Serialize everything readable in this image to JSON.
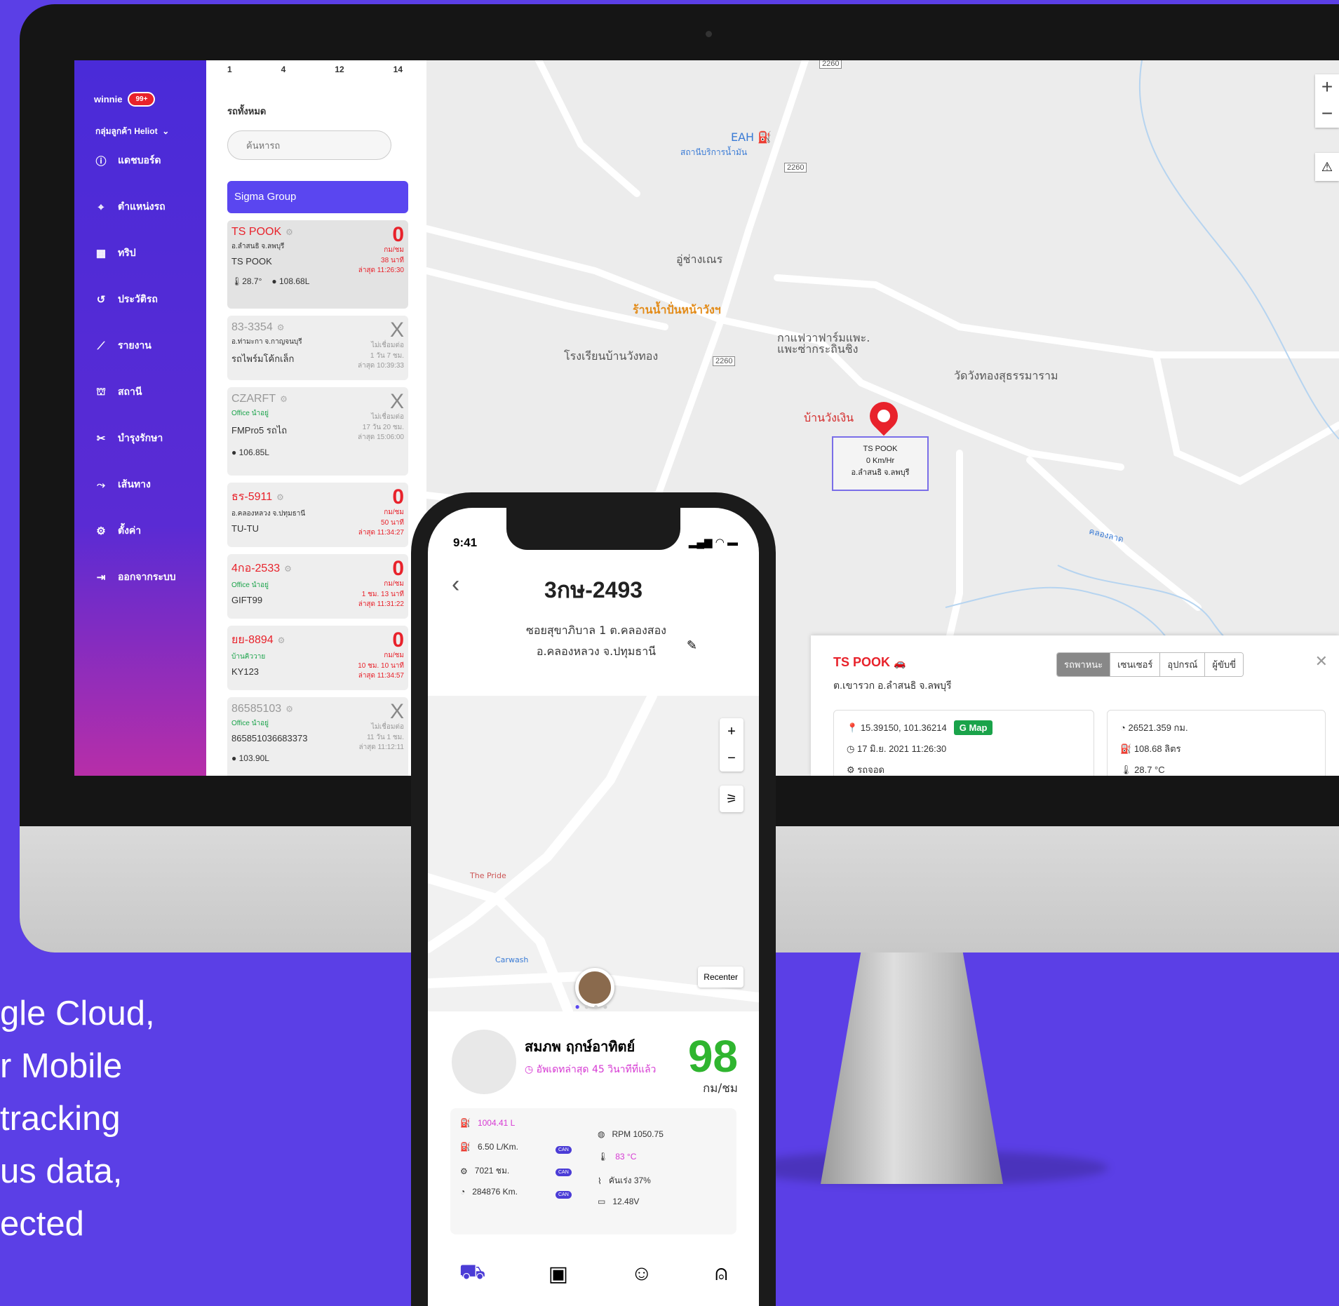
{
  "marketing_lines": [
    "gle Cloud,",
    "r Mobile",
    "tracking",
    "us data,",
    "ected"
  ],
  "sidebar": {
    "user": "winnie",
    "badge": "99+",
    "group": "กลุ่มลูกค้า Heliot",
    "items": [
      {
        "icon": "info-icon",
        "label": "แดชบอร์ด"
      },
      {
        "icon": "location-icon",
        "label": "ตำแหน่งรถ"
      },
      {
        "icon": "map-icon",
        "label": "ทริป"
      },
      {
        "icon": "history-icon",
        "label": "ประวัติรถ"
      },
      {
        "icon": "chart-icon",
        "label": "รายงาน"
      },
      {
        "icon": "station-icon",
        "label": "สถานี"
      },
      {
        "icon": "tools-icon",
        "label": "บำรุงรักษา"
      },
      {
        "icon": "route-icon",
        "label": "เส้นทาง"
      },
      {
        "icon": "gear-icon",
        "label": "ตั้งค่า"
      },
      {
        "icon": "logout-icon",
        "label": "ออกจากระบบ"
      }
    ]
  },
  "list": {
    "counts": [
      "1",
      "4",
      "12",
      "14"
    ],
    "title": "รถทั้งหมด",
    "search_placeholder": "ค้นหารถ",
    "group": "Sigma Group",
    "cards": [
      {
        "name": "TS POOK",
        "loc": "อ.ลำสนธิ จ.ลพบุรี",
        "plate": "TS POOK",
        "big": "0",
        "r1": "กม/ชม",
        "r2": "38 นาที",
        "r3": "ล่าสุด 11:26:30",
        "temp": "28.7°",
        "fuel": "108.68L"
      },
      {
        "name": "83-3354",
        "loc": "อ.ท่ามะกา จ.กาญจนบุรี",
        "plate": "รถไพร์มโค้กเล็ก",
        "big": "X",
        "r1": "ไม่เชื่อมต่อ",
        "r2": "1 วัน 7 ชม.",
        "r3": "ล่าสุด 10:39:33"
      },
      {
        "name": "CZARFT",
        "loc": "Office นำอยู่",
        "plate": "FMPro5 รถไถ",
        "big": "X",
        "r1": "ไม่เชื่อมต่อ",
        "r2": "17 วัน 20 ชม.",
        "r3": "ล่าสุด 15:06:00",
        "fuel": "106.85L"
      },
      {
        "name": "ธร-5911",
        "loc": "อ.คลองหลวง จ.ปทุมธานี",
        "plate": "TU-TU",
        "big": "0",
        "r1": "กม/ชม",
        "r2": "50 นาที",
        "r3": "ล่าสุด 11:34:27"
      },
      {
        "name": "4กอ-2533",
        "loc": "Office นำอยู่",
        "plate": "GIFT99",
        "big": "0",
        "r1": "กม/ชม",
        "r2": "1 ชม. 13 นาที",
        "r3": "ล่าสุด 11:31:22"
      },
      {
        "name": "ยย-8894",
        "loc": "บ้านคิววาย",
        "plate": "KY123",
        "big": "0",
        "r1": "กม/ชม",
        "r2": "10 ชม. 10 นาที",
        "r3": "ล่าสุด 11:34:57"
      },
      {
        "name": "86585103",
        "loc": "Office นำอยู่",
        "plate": "865851036683373",
        "big": "X",
        "r1": "ไม่เชื่อมต่อ",
        "r2": "11 วัน 1 ชม.",
        "r3": "ล่าสุด 11:12:11"
      }
    ],
    "partial": "103.90L"
  },
  "map": {
    "pois": [
      "EAH",
      "สถานีบริการน้ำมัน",
      "อู่ช่างเณร",
      "ร้านน้ำปั่นหน้าวังฯ",
      "กาแฟวาฟาร์มแพะ.",
      "แพะซ่ากระถินชิง",
      "โรงเรียนบ้านวังทอง",
      "วัดวังทองสุธรรมาราม",
      "บ้านวังเงิน",
      "คลองลาด"
    ],
    "road_tags": [
      "2260",
      "2260",
      "2260"
    ],
    "popup": {
      "name": "TS POOK",
      "speed": "0 Km/Hr",
      "loc": "อ.ลำสนธิ จ.ลพบุรี"
    },
    "zoom_in": "+",
    "zoom_out": "−"
  },
  "detail": {
    "name": "TS POOK",
    "address": "ต.เขารวก อ.ลำสนธิ จ.ลพบุรี",
    "tabs": [
      "รถพาหนะ",
      "เซนเซอร์",
      "อุปกรณ์",
      "ผู้ขับขี่"
    ],
    "coords": "15.39150, 101.36214",
    "gmap": "Map",
    "datetime": "17 มิ.ย. 2021 11:26:30",
    "status": "รถจอด",
    "odometer": "26521.359 กม.",
    "fuel": "108.68 ลิตร",
    "temp": "28.7 °C"
  },
  "phone": {
    "time": "9:41",
    "plate": "3กษ-2493",
    "addr1": "ซอยสุขาภิบาล 1 ต.คลองสอง",
    "addr2": "อ.คลองหลวง จ.ปทุมธานี",
    "map_labels": [
      "The Pride",
      "Carwash",
      "Recenter"
    ],
    "driver": "สมภพ ฤกษ์อาทิตย์",
    "updated": "อัพเดทล่าสุด 45 วินาทีที่แล้ว",
    "speed": "98",
    "speed_unit": "กม/ชม",
    "stats_left": [
      "1004.41 L",
      "6.50 L/Km.",
      "7021 ชม.",
      "284876 Km."
    ],
    "can": "CAN",
    "stats_right": [
      "RPM 1050.75",
      "83 °C",
      "คันเร่ง 37%",
      "12.48V"
    ]
  }
}
